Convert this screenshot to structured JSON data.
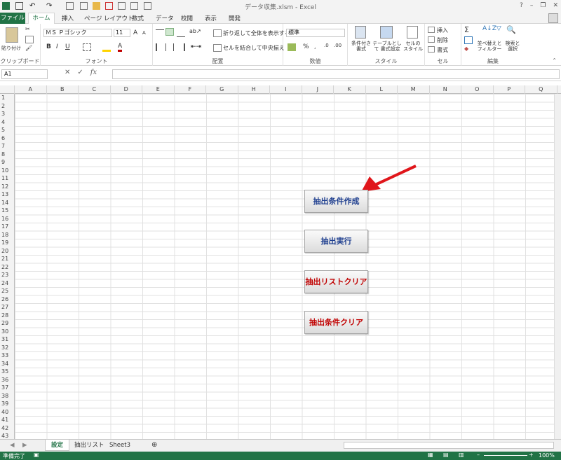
{
  "window": {
    "title": "データ収集.xlsm - Excel",
    "controls": [
      "?",
      "–",
      "❐",
      "✕"
    ]
  },
  "ribbon_tabs": [
    "ファイル",
    "ホーム",
    "挿入",
    "ページ レイアウト",
    "数式",
    "データ",
    "校閲",
    "表示",
    "開発"
  ],
  "clipboard": {
    "paste": "貼り付け",
    "label": "クリップボード"
  },
  "font": {
    "name": "ＭＳ Ｐゴシック",
    "size": "11",
    "bold": "B",
    "italic": "I",
    "underline": "U",
    "label": "フォント",
    "grow": "A",
    "shrink": "A"
  },
  "alignment": {
    "wrap": "折り返して全体を表示する",
    "merge": "セルを結合して中央揃え",
    "label": "配置"
  },
  "number": {
    "format": "標準",
    "percent": "%",
    "label": "数値"
  },
  "styles": {
    "cond": "条件付き 書式",
    "table": "テーブルとして 書式設定",
    "cell": "セルの スタイル",
    "label": "スタイル"
  },
  "cells": {
    "insert": "挿入",
    "delete": "削除",
    "format": "書式",
    "label": "セル"
  },
  "editing": {
    "sort": "並べ替えと フィルター",
    "find": "検索と 選択",
    "label": "編集"
  },
  "formula_bar": {
    "name_box": "A1",
    "fx": "fx",
    "cancel": "✕",
    "enter": "✓"
  },
  "columns": [
    "A",
    "B",
    "C",
    "D",
    "E",
    "F",
    "G",
    "H",
    "I",
    "J",
    "K",
    "L",
    "M",
    "N",
    "O",
    "P",
    "Q"
  ],
  "rows": [
    "1",
    "2",
    "3",
    "4",
    "5",
    "6",
    "7",
    "8",
    "9",
    "10",
    "11",
    "12",
    "13",
    "14",
    "15",
    "16",
    "17",
    "18",
    "19",
    "20",
    "21",
    "22",
    "23",
    "24",
    "25",
    "26",
    "27",
    "28",
    "29",
    "30",
    "31",
    "32",
    "33",
    "34",
    "35",
    "36",
    "37",
    "38",
    "39",
    "40",
    "41",
    "42",
    "43"
  ],
  "buttons": [
    {
      "label": "抽出条件作成",
      "color": "#1f3f8f"
    },
    {
      "label": "抽出実行",
      "color": "#1f3f8f"
    },
    {
      "label": "抽出リストクリア",
      "color": "#c00000"
    },
    {
      "label": "抽出条件クリア",
      "color": "#c00000"
    }
  ],
  "sheet_tabs": [
    "設定",
    "抽出リスト",
    "Sheet3"
  ],
  "status": {
    "ready": "準備完了",
    "zoom": "100%"
  }
}
